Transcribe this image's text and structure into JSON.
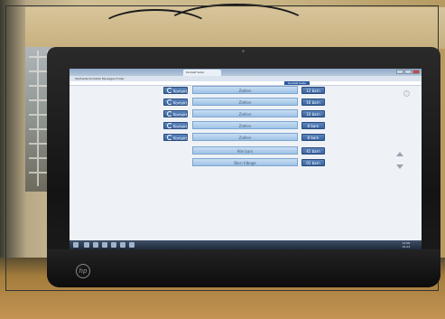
{
  "browser": {
    "tab_title": "Kontakt Seite",
    "bookmarks_text": "Startseite   Kontakte   Messages   Folder",
    "status_text": "Kontakt Seite"
  },
  "contacts": [
    {
      "button_label": "Kontakt",
      "name": "Zahlen",
      "count": "12 barn"
    },
    {
      "button_label": "Kontakt",
      "name": "Zahlen",
      "count": "16 barn"
    },
    {
      "button_label": "Kontakt",
      "name": "Zahlen",
      "count": "10 barn"
    },
    {
      "button_label": "Kontakt",
      "name": "Zahlen",
      "count": "8 barn"
    },
    {
      "button_label": "Kontakt",
      "name": "Zahlen",
      "count": "8 barn"
    }
  ],
  "summary_rows": [
    {
      "name": "Alle barn",
      "count": "41 barn"
    },
    {
      "name": "Barn tilbage",
      "count": "01 barn"
    }
  ],
  "help_icon": "help-circle",
  "clock": {
    "time": "12:00",
    "date": "01-01"
  },
  "brand_logo": "hp"
}
